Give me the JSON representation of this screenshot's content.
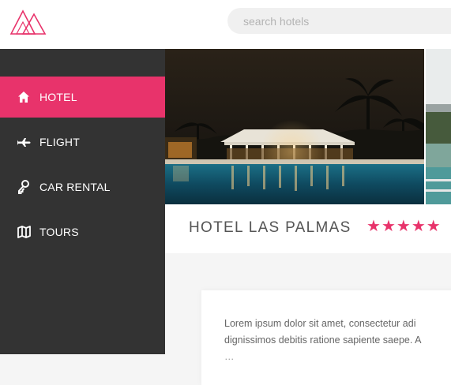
{
  "search": {
    "placeholder": "search hotels"
  },
  "sidebar": {
    "items": [
      {
        "label": "HOTEL",
        "icon": "home-icon",
        "active": true
      },
      {
        "label": "FLIGHT",
        "icon": "airplane-icon",
        "active": false
      },
      {
        "label": "CAR RENTAL",
        "icon": "key-icon",
        "active": false
      },
      {
        "label": "TOURS",
        "icon": "map-icon",
        "active": false
      }
    ]
  },
  "hotel": {
    "name": "HOTEL LAS PALMAS",
    "rating": 5,
    "stars": "★★★★★",
    "description": [
      "Lorem ipsum dolor sit amet, consectetur adi",
      "dignissimos debitis ratione sapiente saepe. A",
      "…"
    ]
  },
  "colors": {
    "accent": "#e8336b",
    "sidebar": "#333333",
    "background": "#f5f5f5"
  }
}
